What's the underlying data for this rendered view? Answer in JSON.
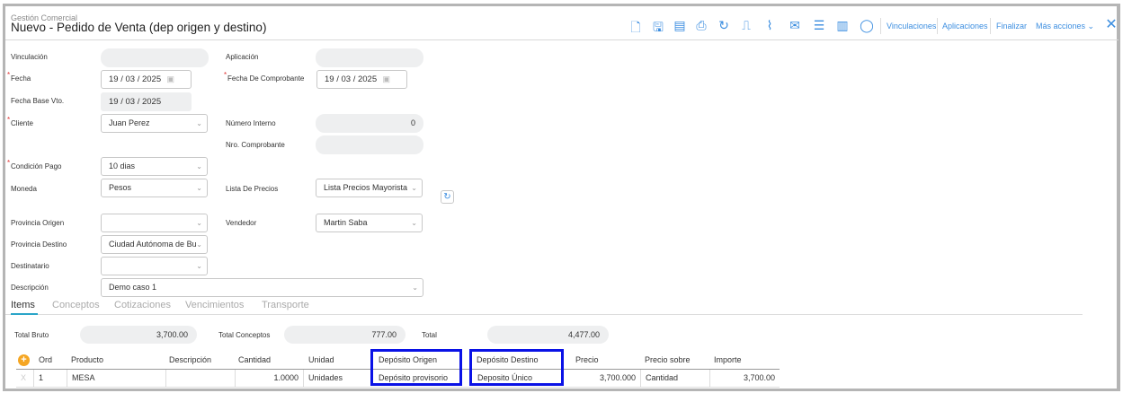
{
  "header": {
    "module": "Gestión Comercial",
    "title": "Nuevo - Pedido de Venta (dep origen y destino)"
  },
  "toolbar": {
    "icons": [
      "new-document-icon",
      "save-icon",
      "copy-icon",
      "print-icon",
      "history-icon",
      "pdf-icon",
      "attach-icon",
      "email-icon",
      "checklist-icon",
      "notebook-icon",
      "comment-icon"
    ],
    "links": [
      "Vinculaciones",
      "Aplicaciones",
      "Finalizar",
      "Más acciones"
    ]
  },
  "form": {
    "vinculacion": {
      "label": "Vinculación",
      "value": ""
    },
    "aplicacion": {
      "label": "Aplicación",
      "value": ""
    },
    "fecha": {
      "label": "Fecha",
      "value": "19 / 03 / 2025"
    },
    "fecha_comprobante": {
      "label": "Fecha De Comprobante",
      "value": "19 / 03 / 2025"
    },
    "fecha_base": {
      "label": "Fecha Base Vto.",
      "value": "19 / 03 / 2025"
    },
    "cliente": {
      "label": "Cliente",
      "value": "Juan Perez"
    },
    "numero_interno": {
      "label": "Número Interno",
      "value": "0"
    },
    "nro_comprobante": {
      "label": "Nro. Comprobante",
      "value": ""
    },
    "condicion_pago": {
      "label": "Condición Pago",
      "value": "10 dias"
    },
    "moneda": {
      "label": "Moneda",
      "value": "Pesos"
    },
    "lista_precios": {
      "label": "Lista De Precios",
      "value": "Lista Precios Mayorista"
    },
    "provincia_origen": {
      "label": "Provincia Origen",
      "value": ""
    },
    "vendedor": {
      "label": "Vendedor",
      "value": "Martin Saba"
    },
    "provincia_destino": {
      "label": "Provincia Destino",
      "value": "Ciudad Autónoma de Bu"
    },
    "destinatario": {
      "label": "Destinatario",
      "value": ""
    },
    "descripcion": {
      "label": "Descripción",
      "value": "Demo caso 1"
    }
  },
  "tabs": [
    "Items",
    "Conceptos",
    "Cotizaciones",
    "Vencimientos",
    "Transporte"
  ],
  "totals": {
    "bruto_label": "Total Bruto",
    "bruto": "3,700.00",
    "conceptos_label": "Total Conceptos",
    "conceptos": "777.00",
    "total_label": "Total",
    "total": "4,477.00"
  },
  "table": {
    "headers": [
      "Ord",
      "Producto",
      "Descripción",
      "Cantidad",
      "Unidad",
      "Depósito Origen",
      "Depósito Destino",
      "Precio",
      "Precio sobre",
      "Importe"
    ],
    "rows": [
      {
        "delete": "X",
        "ord": "1",
        "producto": "MESA",
        "descripcion": "",
        "cantidad": "1.0000",
        "unidad": "Unidades",
        "dep_origen": "Depósito provisorio",
        "dep_destino": "Deposito Único",
        "precio": "3,700.000",
        "precio_sobre": "Cantidad",
        "importe": "3,700.00"
      }
    ]
  },
  "colors": {
    "accent": "#3c8ee0",
    "highlight": "#0a12e6",
    "tab_underline": "#2aa5c8",
    "add_button": "#f5a623"
  }
}
